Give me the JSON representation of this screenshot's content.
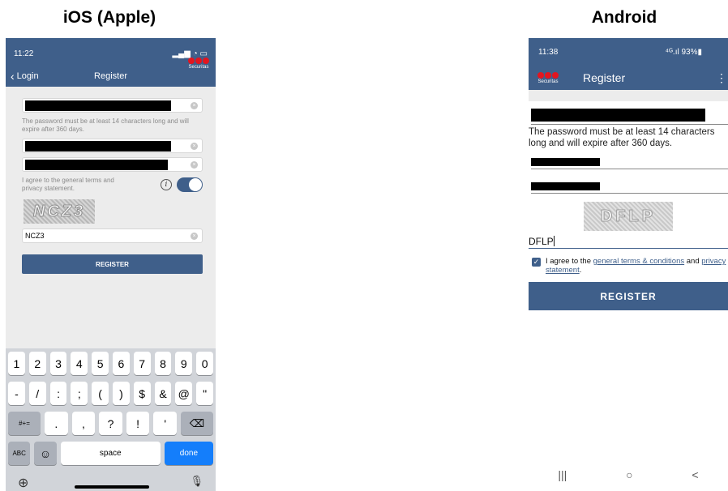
{
  "headings": {
    "ios": "iOS (Apple)",
    "android": "Android"
  },
  "ios": {
    "status_time": "11:22",
    "status_icons": "▂▄▆ ◔ ▭",
    "back_label": "Login",
    "title": "Register",
    "logo_text": "Securitas",
    "password_hint": "The password must be at least 14 characters long and will expire after 360 days.",
    "agree_text": "I agree to the general terms and privacy statement.",
    "captcha_image_text": "NCZ3",
    "captcha_value": "NCZ3",
    "register_label": "REGISTER",
    "keyboard": {
      "row1": [
        "1",
        "2",
        "3",
        "4",
        "5",
        "6",
        "7",
        "8",
        "9",
        "0"
      ],
      "row2": [
        "-",
        "/",
        ":",
        ";",
        "(",
        ")",
        "$",
        "&",
        "@",
        "\""
      ],
      "row3": [
        "#+=",
        ".",
        ",",
        "?",
        "!",
        "'",
        "⌫"
      ],
      "abc": "ABC",
      "emoji": "☺",
      "space": "space",
      "done": "done",
      "globe": "⊕",
      "mic": "🎙"
    }
  },
  "android": {
    "status_time": "11:38",
    "status_icons": "⁴ᴳ.ıl 93%▮",
    "logo_text": "Securitas",
    "title": "Register",
    "menu_icon": "⋮",
    "password_hint": "The password must be at least 14 characters long and will expire after 360 days.",
    "captcha_image_text": "DFLP",
    "captcha_value": "DFLP",
    "agree_prefix": "I agree to the ",
    "agree_link1": "general terms & conditions",
    "agree_mid": " and ",
    "agree_link2": "privacy statement",
    "agree_suffix": ".",
    "register_label": "REGISTER",
    "nav": {
      "recent": "|||",
      "home": "○",
      "back": "<"
    }
  }
}
